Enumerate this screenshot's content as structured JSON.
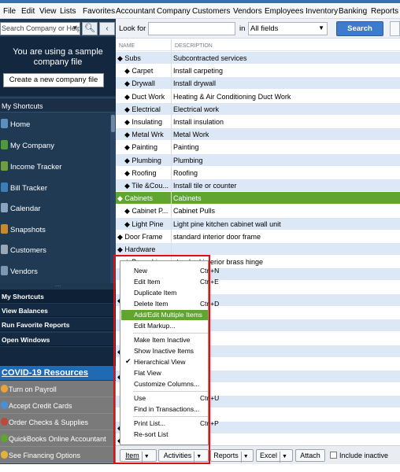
{
  "menubar": {
    "items": [
      "File",
      "Edit",
      "View",
      "Lists",
      "Favorites",
      "Accountant",
      "Company",
      "Customers",
      "Vendors",
      "Employees",
      "Inventory",
      "Banking",
      "Reports"
    ]
  },
  "sidebar": {
    "search_placeholder": "Search Company or Help",
    "search_icon": "magnifier-icon",
    "collapse_icon": "chevron-left-icon",
    "sample_notice": "You are using a sample company file",
    "create_button": "Create a new company file",
    "shortcuts_header": "My Shortcuts",
    "items": [
      {
        "label": "Home",
        "icon": "home-icon",
        "color": "#5a8fbf"
      },
      {
        "label": "My Company",
        "icon": "company-icon",
        "color": "#4f9a3a"
      },
      {
        "label": "Income Tracker",
        "icon": "income-icon",
        "color": "#6f9e3c"
      },
      {
        "label": "Bill Tracker",
        "icon": "bill-icon",
        "color": "#3c7fb8"
      },
      {
        "label": "Calendar",
        "icon": "calendar-icon",
        "color": "#8aa4c0"
      },
      {
        "label": "Snapshots",
        "icon": "snapshot-icon",
        "color": "#c98a2f"
      },
      {
        "label": "Customers",
        "icon": "customers-icon",
        "color": "#9aa9b8"
      },
      {
        "label": "Vendors",
        "icon": "vendors-icon",
        "color": "#7d97b3"
      }
    ],
    "grip": "....",
    "dark_sections": [
      "My Shortcuts",
      "View Balances",
      "Run Favorite Reports",
      "Open Windows"
    ],
    "covid_header": "COVID-19 Resources",
    "covid_items": [
      {
        "label": "Turn on Payroll",
        "color": "#e6a43a"
      },
      {
        "label": "Accept Credit Cards",
        "color": "#4a90d9"
      },
      {
        "label": "Order Checks & Supplies",
        "color": "#c0473a"
      },
      {
        "label": "QuickBooks Online Accountant",
        "color": "#5fa530"
      },
      {
        "label": "See Financing Options",
        "color": "#e3b23c"
      }
    ]
  },
  "toolbar": {
    "look_for_label": "Look for",
    "look_for_value": "",
    "in_label": "in",
    "field_select": "All fields",
    "search_button": "Search"
  },
  "list": {
    "columns": {
      "name": "NAME",
      "description": "DESCRIPTION"
    },
    "rows": [
      {
        "name": "◆ Subs",
        "desc": "Subcontracted services",
        "indent": 0,
        "style": "alt"
      },
      {
        "name": "◆ Carpet",
        "desc": "Install carpeting",
        "indent": 1,
        "style": ""
      },
      {
        "name": "◆ Drywall",
        "desc": "Install drywall",
        "indent": 1,
        "style": "alt"
      },
      {
        "name": "◆ Duct Work",
        "desc": "Heating & Air Conditioning Duct Work",
        "indent": 1,
        "style": ""
      },
      {
        "name": "◆ Electrical",
        "desc": "Electrical work",
        "indent": 1,
        "style": "alt"
      },
      {
        "name": "◆ Insulating",
        "desc": "Install insulation",
        "indent": 1,
        "style": ""
      },
      {
        "name": "◆ Metal Wrk",
        "desc": "Metal Work",
        "indent": 1,
        "style": "alt"
      },
      {
        "name": "◆ Painting",
        "desc": "Painting",
        "indent": 1,
        "style": ""
      },
      {
        "name": "◆ Plumbing",
        "desc": "Plumbing",
        "indent": 1,
        "style": "alt"
      },
      {
        "name": "◆ Roofing",
        "desc": "Roofing",
        "indent": 1,
        "style": ""
      },
      {
        "name": "◆ Tile &Cou...",
        "desc": "Install tile or counter",
        "indent": 1,
        "style": "alt"
      },
      {
        "name": "◆ Cabinets",
        "desc": "Cabinets",
        "indent": 0,
        "style": "sel"
      },
      {
        "name": "◆ Cabinet P...",
        "desc": "Cabinet Pulls",
        "indent": 1,
        "style": ""
      },
      {
        "name": "◆ Light Pine",
        "desc": "Light pine kitchen cabinet wall unit",
        "indent": 1,
        "style": "alt"
      },
      {
        "name": "◆ Door Frame",
        "desc": "standard interior door frame",
        "indent": 0,
        "style": ""
      },
      {
        "name": "◆ Hardware",
        "desc": "",
        "indent": 0,
        "style": "alt"
      },
      {
        "name": "◆ Brass hin...",
        "desc": "standard interior brass hinge",
        "indent": 1,
        "style": ""
      },
      {
        "name": "",
        "desc": "es",
        "indent": 1,
        "style": "alt"
      },
      {
        "name": "",
        "desc": "orknobs",
        "indent": 1,
        "style": ""
      },
      {
        "name": "◆",
        "desc": "",
        "indent": 0,
        "style": "alt"
      },
      {
        "name": "",
        "desc": "",
        "indent": 0,
        "style": ""
      },
      {
        "name": "",
        "desc": "",
        "indent": 0,
        "style": "alt"
      },
      {
        "name": "",
        "desc": "oor",
        "indent": 0,
        "style": ""
      },
      {
        "name": "◆",
        "desc": "",
        "indent": 0,
        "style": "alt"
      },
      {
        "name": "",
        "desc": "",
        "indent": 0,
        "style": ""
      },
      {
        "name": "◆",
        "desc": "",
        "indent": 0,
        "style": "alt"
      },
      {
        "name": "",
        "desc": "",
        "indent": 0,
        "style": ""
      },
      {
        "name": "",
        "desc": "",
        "indent": 0,
        "style": "alt"
      },
      {
        "name": "",
        "desc": "",
        "indent": 0,
        "style": ""
      },
      {
        "name": "◆",
        "desc": "",
        "indent": 0,
        "style": "alt"
      },
      {
        "name": "◆",
        "desc": "",
        "indent": 0,
        "style": ""
      },
      {
        "name": "",
        "desc": "nter top",
        "indent": 0,
        "style": "alt"
      },
      {
        "name": "",
        "desc": "",
        "indent": 0,
        "style": ""
      }
    ]
  },
  "context_menu": {
    "items": [
      {
        "label": "New",
        "shortcut": "Ctrl+N",
        "sep": false,
        "hl": false,
        "check": false
      },
      {
        "label": "Edit Item",
        "shortcut": "Ctrl+E",
        "sep": false,
        "hl": false,
        "check": false
      },
      {
        "label": "Duplicate Item",
        "shortcut": "",
        "sep": false,
        "hl": false,
        "check": false
      },
      {
        "label": "Delete Item",
        "shortcut": "Ctrl+D",
        "sep": false,
        "hl": false,
        "check": false
      },
      {
        "label": "Add/Edit Multiple Items",
        "shortcut": "",
        "sep": false,
        "hl": true,
        "check": false
      },
      {
        "label": "Edit Markup...",
        "shortcut": "",
        "sep": true,
        "hl": false,
        "check": false
      },
      {
        "label": "Make Item Inactive",
        "shortcut": "",
        "sep": false,
        "hl": false,
        "check": false
      },
      {
        "label": "Show Inactive Items",
        "shortcut": "",
        "sep": false,
        "hl": false,
        "check": false
      },
      {
        "label": "Hierarchical View",
        "shortcut": "",
        "sep": false,
        "hl": false,
        "check": true
      },
      {
        "label": "Flat View",
        "shortcut": "",
        "sep": false,
        "hl": false,
        "check": false
      },
      {
        "label": "Customize Columns...",
        "shortcut": "",
        "sep": true,
        "hl": false,
        "check": false
      },
      {
        "label": "Use",
        "shortcut": "Ctrl+U",
        "sep": false,
        "hl": false,
        "check": false
      },
      {
        "label": "Find in Transactions...",
        "shortcut": "",
        "sep": true,
        "hl": false,
        "check": false
      },
      {
        "label": "Print List...",
        "shortcut": "Ctrl+P",
        "sep": false,
        "hl": false,
        "check": false
      },
      {
        "label": "Re-sort List",
        "shortcut": "",
        "sep": false,
        "hl": false,
        "check": false
      }
    ]
  },
  "bottombar": {
    "item": "Item",
    "activities": "Activities",
    "reports": "Reports",
    "excel": "Excel",
    "attach": "Attach",
    "include_inactive": "Include inactive"
  }
}
